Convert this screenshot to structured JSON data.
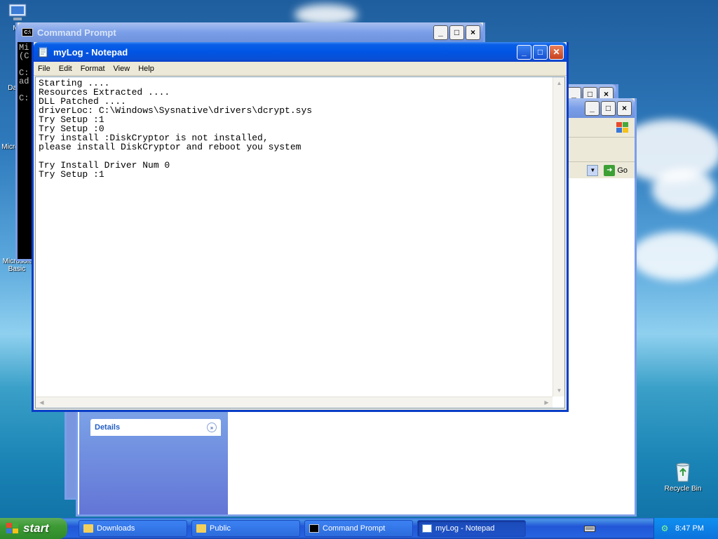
{
  "desktop": {
    "icons": [
      {
        "label": "My"
      },
      {
        "label": "Dat"
      },
      {
        "label": "Micros"
      },
      {
        "label": "Microsoft Basic"
      },
      {
        "label": "Recycle Bin"
      }
    ]
  },
  "cmd_window": {
    "title": "Command Prompt",
    "lines": "Mi\n(C\n\nC:\nad\n\nC:"
  },
  "explorer": {
    "details_label": "Details",
    "go_label": "Go"
  },
  "notepad": {
    "title": "myLog - Notepad",
    "menu": [
      "File",
      "Edit",
      "Format",
      "View",
      "Help"
    ],
    "content": "Starting ....\nResources Extracted ....\nDLL Patched ....\ndriverLoc: C:\\Windows\\Sysnative\\drivers\\dcrypt.sys\nTry Setup :1\nTry Setup :0\nTry install :DiskCryptor is not installed,\nplease install DiskCryptor and reboot you system\n\nTry Install Driver Num 0\nTry Setup :1"
  },
  "taskbar": {
    "start_label": "start",
    "tasks": [
      {
        "label": "Downloads",
        "icon": "folder-icon"
      },
      {
        "label": "Public",
        "icon": "folder-icon"
      },
      {
        "label": "Command Prompt",
        "icon": "cmd-icon"
      },
      {
        "label": "myLog - Notepad",
        "icon": "notepad-icon"
      }
    ],
    "clock": "8:47 PM"
  },
  "colors": {
    "title_active": "#0055e5",
    "close_button": "#c8401e",
    "taskbar": "#2157d7",
    "start_button": "#3c9a34"
  }
}
